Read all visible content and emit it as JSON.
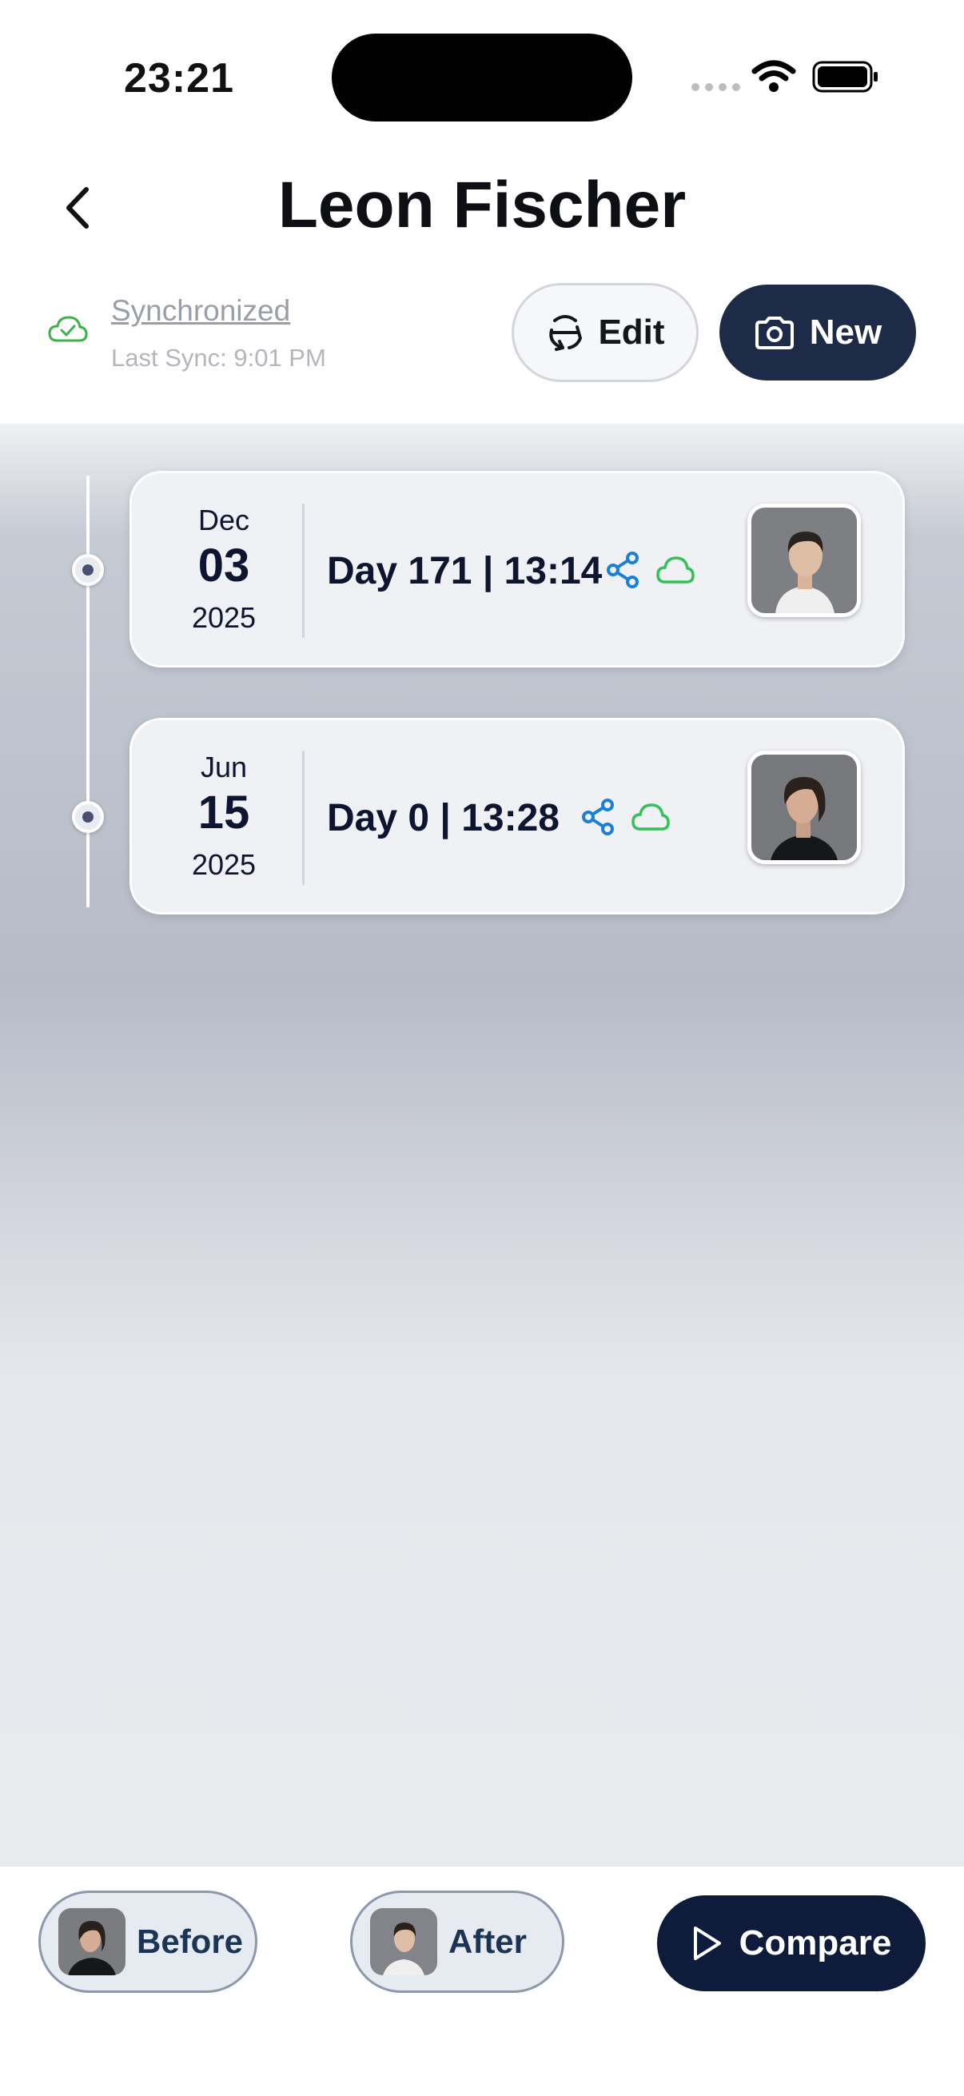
{
  "status_bar": {
    "time": "23:21"
  },
  "header": {
    "title": "Leon Fischer",
    "back_icon": "chevron-left-icon"
  },
  "sync": {
    "status": "Synchronized",
    "last_sync": "Last Sync: 9:01 PM",
    "icon": "cloud-check-icon",
    "color": "#3bb34a"
  },
  "actions": {
    "edit_label": "Edit",
    "edit_icon": "rotate-icon",
    "new_label": "New",
    "new_icon": "camera-icon",
    "new_color": "#1e2b48"
  },
  "entries": [
    {
      "month": "Dec",
      "day": "03",
      "year": "2025",
      "label": "Day 171 | 13:14",
      "share_icon": "share-icon",
      "cloud_icon": "cloud-icon"
    },
    {
      "month": "Jun",
      "day": "15",
      "year": "2025",
      "label": "Day 0 | 13:28",
      "share_icon": "share-icon",
      "cloud_icon": "cloud-icon"
    }
  ],
  "bottom": {
    "before_label": "Before",
    "after_label": "After",
    "compare_label": "Compare",
    "compare_icon": "play-icon",
    "compare_color": "#0f1b3a"
  },
  "colors": {
    "accent_blue": "#1a7fd8",
    "cloud_green": "#36c05a",
    "text_dark": "#0d1530"
  }
}
